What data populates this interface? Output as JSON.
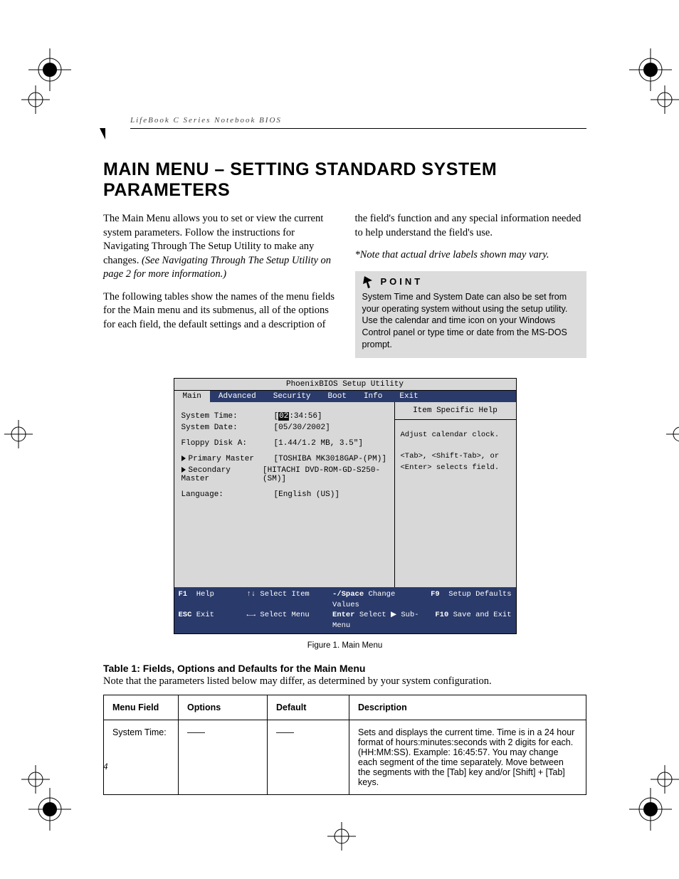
{
  "header": {
    "running_head": "LifeBook C Series Notebook BIOS"
  },
  "title": "MAIN MENU – SETTING STANDARD SYSTEM PARAMETERS",
  "body": {
    "left_p1": "The Main Menu allows you to set or view the current system parameters. Follow the instructions for Navigating Through The Setup Utility to make any changes.",
    "left_p1_italic": "(See Navigating Through The Setup Utility on page 2 for more information.)",
    "left_p2": "The following tables show the names of the menu fields for the Main menu and its submenus, all of the options for each field, the default settings and a description of",
    "right_p1": "the field's function and any special information needed to help understand the field's use.",
    "right_note": "*Note that actual drive labels shown may vary."
  },
  "point": {
    "heading": "POINT",
    "text": "System Time and System Date can also be set from your operating system without using the setup utility. Use the calendar and time icon on your Windows Control panel or type time or date from the MS-DOS prompt."
  },
  "bios": {
    "title": "PhoenixBIOS Setup Utility",
    "menus": [
      "Main",
      "Advanced",
      "Security",
      "Boot",
      "Info",
      "Exit"
    ],
    "active_menu": "Main",
    "fields": {
      "system_time_label": "System Time:",
      "system_time_hh": "02",
      "system_time_rest": ":34:56]",
      "system_date_label": "System Date:",
      "system_date_value": "[05/30/2002]",
      "floppy_label": "Floppy Disk A:",
      "floppy_value": "[1.44/1.2 MB, 3.5\"]",
      "primary_label": "Primary Master",
      "primary_value": "[TOSHIBA MK3018GAP-(PM)]",
      "secondary_label": "Secondary Master",
      "secondary_value": "[HITACHI DVD-ROM-GD-S250-(SM)]",
      "language_label": "Language:",
      "language_value": "[English (US)]"
    },
    "help": {
      "heading": "Item Specific Help",
      "line1": "Adjust calendar clock.",
      "line2": "<Tab>, <Shift-Tab>, or <Enter> selects field."
    },
    "footer": {
      "f1": "F1",
      "f1_label": "Help",
      "esc": "ESC",
      "esc_label": "Exit",
      "updown": "↑↓ Select Item",
      "leftright": "←→ Select Menu",
      "minus": "-/Space",
      "minus_label": "Change Values",
      "enter": "Enter",
      "enter_label": "Select ▶ Sub-Menu",
      "f9": "F9",
      "f9_label": "Setup Defaults",
      "f10": "F10",
      "f10_label": "Save and Exit"
    }
  },
  "figure_caption": "Figure 1.   Main Menu",
  "table": {
    "title": "Table 1: Fields, Options and Defaults for the Main Menu",
    "note": "Note that the parameters listed below may differ, as determined by your system configuration.",
    "headers": {
      "menu_field": "Menu Field",
      "options": "Options",
      "default": "Default",
      "description": "Description"
    },
    "rows": [
      {
        "menu_field": "System Time:",
        "options": "——",
        "default": "——",
        "description": "Sets and displays the current time. Time is in a 24 hour format of hours:minutes:seconds with 2 digits for each. (HH:MM:SS). Example: 16:45:57. You may change each segment of the time separately. Move between the segments with the [Tab] key and/or [Shift] + [Tab] keys."
      }
    ]
  },
  "page_number": "4"
}
